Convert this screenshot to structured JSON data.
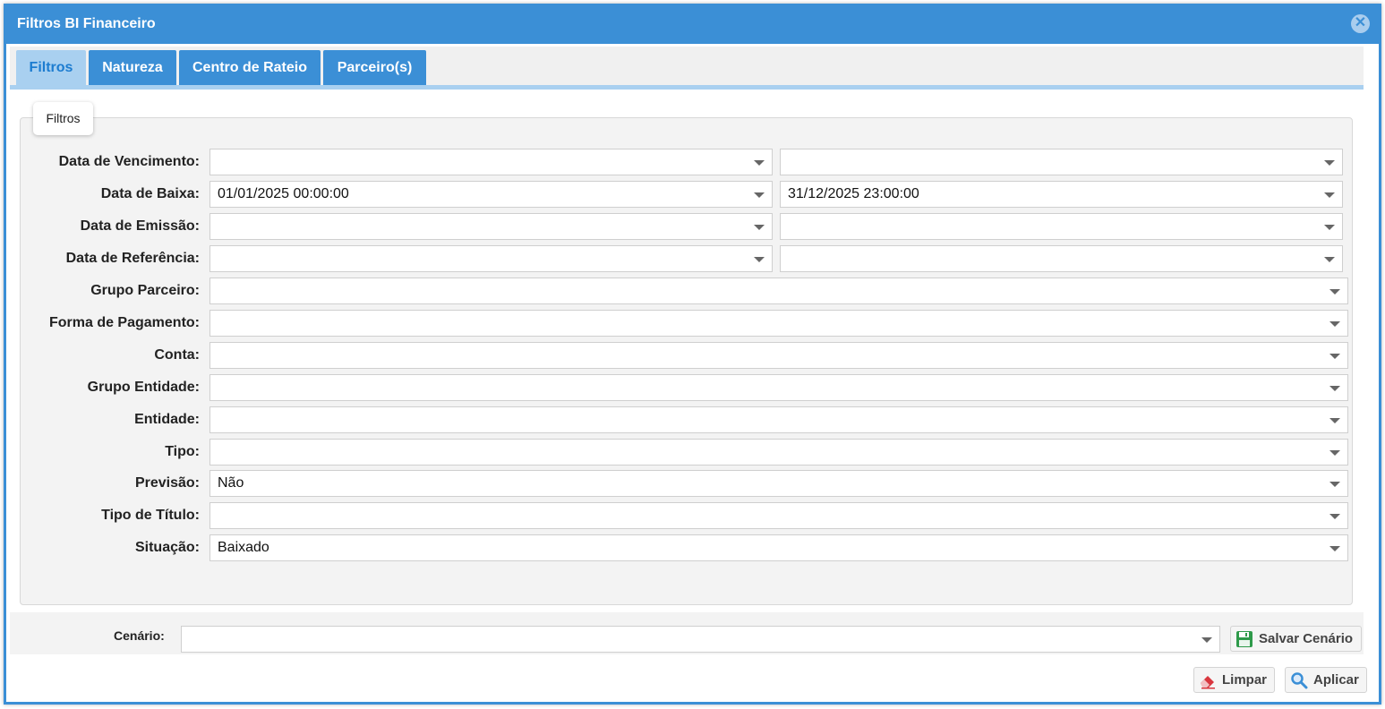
{
  "dialog": {
    "title": "Filtros BI Financeiro",
    "close_symbol": "✕"
  },
  "tabs": [
    {
      "label": "Filtros",
      "active": true
    },
    {
      "label": "Natureza",
      "active": false
    },
    {
      "label": "Centro de Rateio",
      "active": false
    },
    {
      "label": "Parceiro(s)",
      "active": false
    }
  ],
  "filters": {
    "legend": "Filtros",
    "data_vencimento": {
      "label": "Data de Vencimento:",
      "from": "",
      "to": ""
    },
    "data_baixa": {
      "label": "Data de Baixa:",
      "from": "01/01/2025 00:00:00",
      "to": "31/12/2025 23:00:00"
    },
    "data_emissao": {
      "label": "Data de Emissão:",
      "from": "",
      "to": ""
    },
    "data_referencia": {
      "label": "Data de Referência:",
      "from": "",
      "to": ""
    },
    "grupo_parceiro": {
      "label": "Grupo Parceiro:",
      "value": ""
    },
    "forma_pagamento": {
      "label": "Forma de Pagamento:",
      "value": ""
    },
    "conta": {
      "label": "Conta:",
      "value": ""
    },
    "grupo_entidade": {
      "label": "Grupo Entidade:",
      "value": ""
    },
    "entidade": {
      "label": "Entidade:",
      "value": ""
    },
    "tipo": {
      "label": "Tipo:",
      "value": ""
    },
    "previsao": {
      "label": "Previsão:",
      "value": "Não"
    },
    "tipo_titulo": {
      "label": "Tipo de Título:",
      "value": ""
    },
    "situacao": {
      "label": "Situação:",
      "value": "Baixado"
    }
  },
  "footer": {
    "cenario_label": "Cenário:",
    "cenario_value": "",
    "save_label": "Salvar Cenário",
    "clear_label": "Limpar",
    "apply_label": "Aplicar"
  },
  "colors": {
    "header": "#3b8fd6",
    "tab_active_bg": "#a9d0f0",
    "tab_active_text": "#1c7cd0",
    "save_icon": "#2e9a4a",
    "eraser_icon": "#d9363e",
    "search_icon": "#3b8fd6"
  },
  "icons": {
    "close": "close-icon",
    "dropdown": "chevron-down-icon",
    "save": "floppy-disk-icon",
    "clear": "eraser-icon",
    "apply": "search-icon"
  }
}
